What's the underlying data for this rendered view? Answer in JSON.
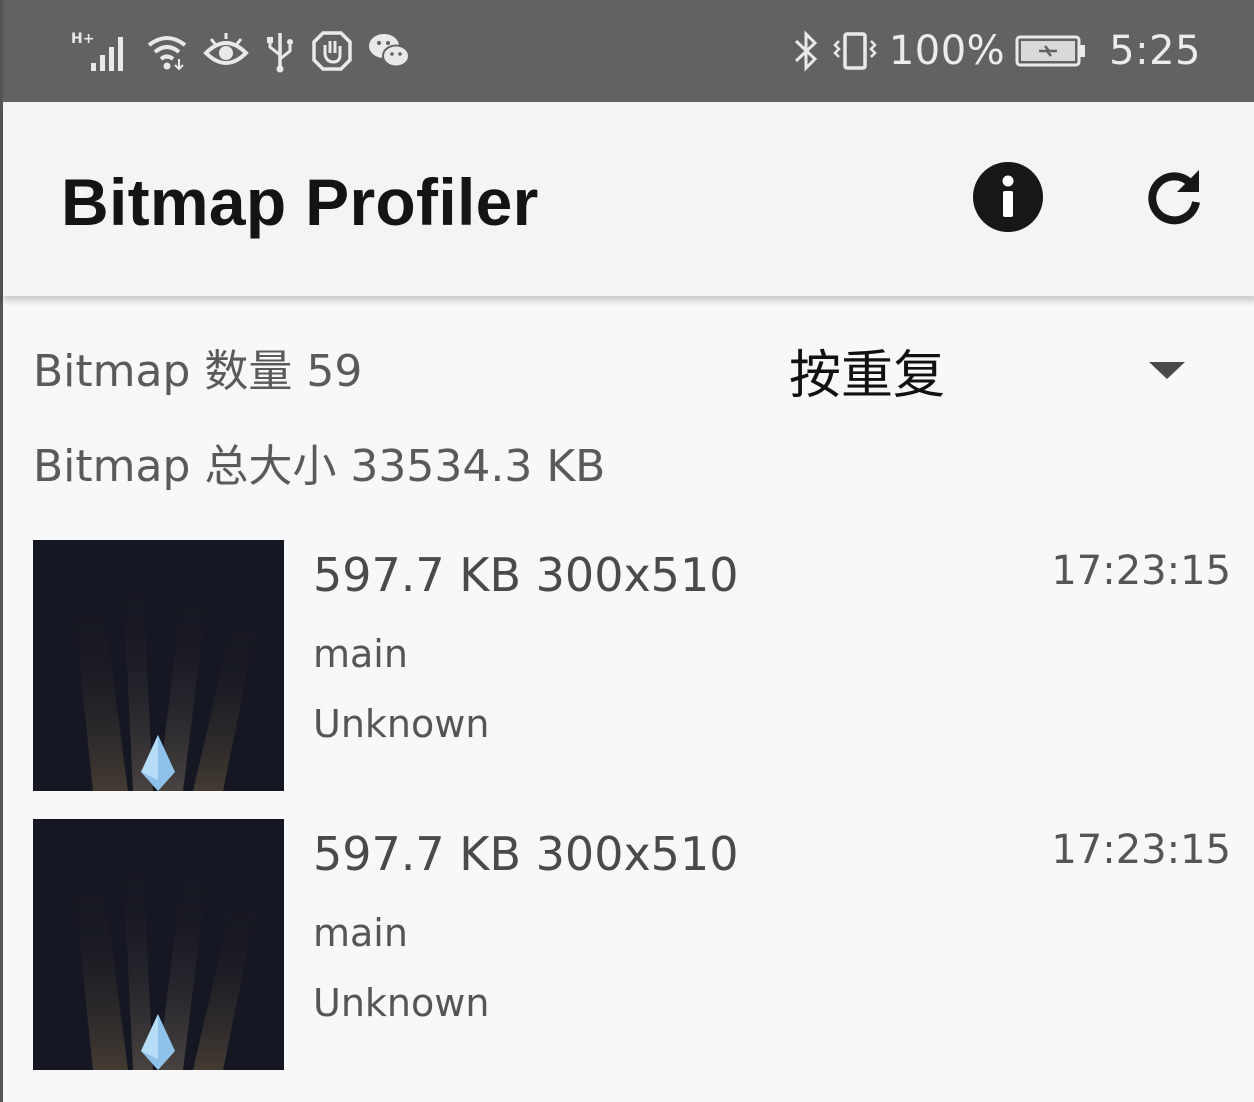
{
  "status_bar": {
    "network_type": "H+",
    "battery_percent": "100%",
    "time": "5:25",
    "icons_left": [
      "signal-icon",
      "wifi-icon",
      "eye-icon",
      "usb-icon",
      "hand-icon",
      "wechat-icon"
    ],
    "icons_right": [
      "bluetooth-icon",
      "vibrate-icon",
      "battery-icon"
    ]
  },
  "toolbar": {
    "title": "Bitmap Profiler",
    "actions": [
      "info-icon",
      "refresh-icon"
    ]
  },
  "summary": {
    "count_text": "Bitmap 数量 59",
    "total_size_text": "Bitmap 总大小 33534.3 KB"
  },
  "sort": {
    "selected": "按重复"
  },
  "bitmaps": [
    {
      "size_dims": "597.7 KB 300x510",
      "thread": "main",
      "source": "Unknown",
      "time": "17:23:15"
    },
    {
      "size_dims": "597.7 KB 300x510",
      "thread": "main",
      "source": "Unknown",
      "time": "17:23:15"
    }
  ],
  "colors": {
    "status_bar_bg": "#626262",
    "toolbar_bg": "#f4f4f5",
    "content_bg": "#f7f8fa",
    "thumbnail_bg": "#151722",
    "crystal": "#8fc2ea"
  }
}
